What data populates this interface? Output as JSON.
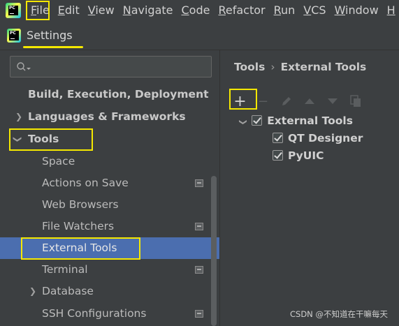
{
  "menubar": {
    "app_icon": "pycharm-icon",
    "items": [
      {
        "underline": "F",
        "rest": "ile"
      },
      {
        "underline": "E",
        "rest": "dit"
      },
      {
        "underline": "V",
        "rest": "iew"
      },
      {
        "underline": "N",
        "rest": "avigate"
      },
      {
        "underline": "C",
        "rest": "ode"
      },
      {
        "underline": "R",
        "rest": "efactor"
      },
      {
        "underline": "R",
        "rest": "un"
      },
      {
        "underline": "V",
        "rest": "CS"
      },
      {
        "underline": "W",
        "rest": "indow"
      },
      {
        "underline": "H",
        "rest": ""
      }
    ]
  },
  "titlebar": {
    "title": "Settings",
    "icon": "pycharm-icon"
  },
  "search": {
    "icon": "search-icon",
    "value": ""
  },
  "tree": {
    "build": "Build, Execution, Deployment",
    "languages": "Languages & Frameworks",
    "tools": "Tools",
    "space": "Space",
    "actions_on_save": "Actions on Save",
    "web_browsers": "Web Browsers",
    "file_watchers": "File Watchers",
    "external_tools": "External Tools",
    "terminal": "Terminal",
    "database": "Database",
    "ssh": "SSH Configurations"
  },
  "breadcrumb": {
    "parent": "Tools",
    "separator": "›",
    "current": "External Tools"
  },
  "toolbar": {
    "add": "+",
    "remove": "−",
    "edit_icon": "pencil-icon",
    "up_icon": "arrow-up-icon",
    "down_icon": "arrow-down-icon",
    "copy_icon": "copy-icon"
  },
  "external_tools": {
    "group": "External Tools",
    "items": [
      "QT Designer",
      "PyUIC"
    ]
  },
  "colors": {
    "selection": "#4b6eaf",
    "highlight": "#f5e800",
    "background": "#3c3f41"
  },
  "watermark": "CSDN @不知道在干嘛每天"
}
